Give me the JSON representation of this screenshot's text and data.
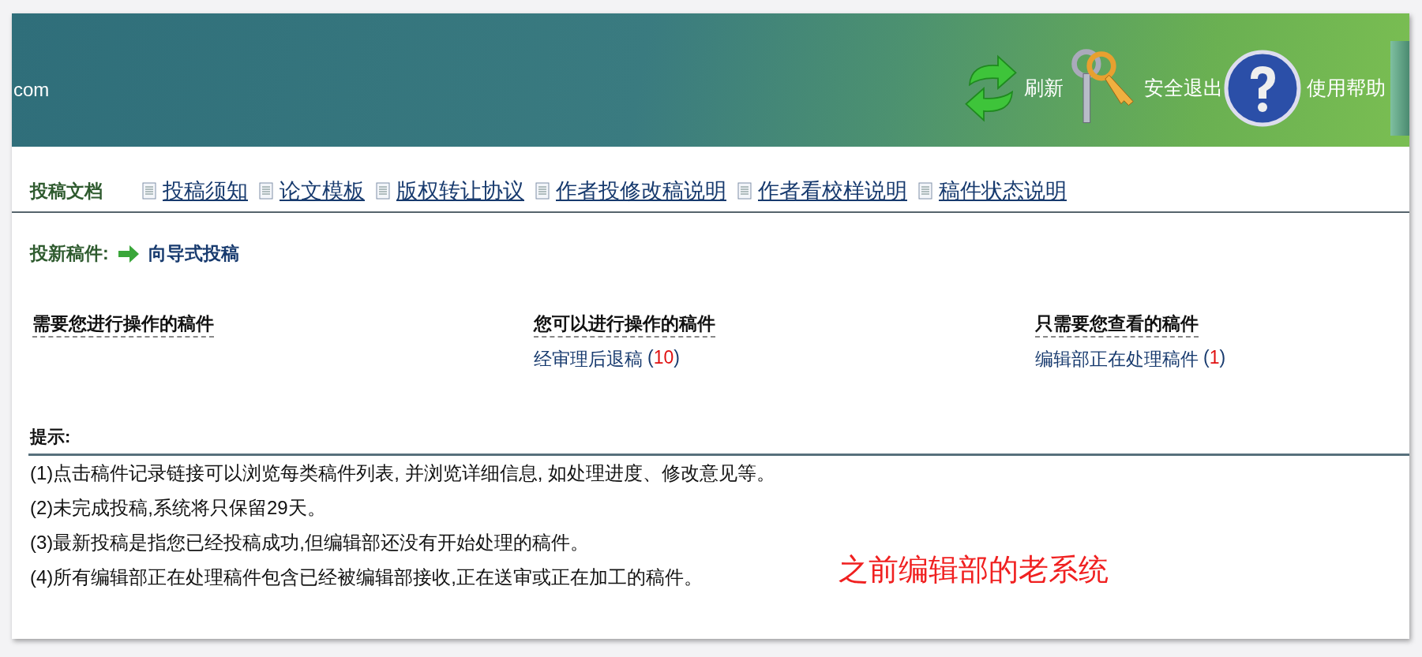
{
  "header": {
    "site_text": "com",
    "actions": [
      {
        "kind": "refresh",
        "label": "刷新"
      },
      {
        "kind": "logout",
        "label": "安全退出"
      },
      {
        "kind": "help",
        "label": "使用帮助"
      }
    ]
  },
  "docs": {
    "title": "投稿文档",
    "links": [
      "投稿须知",
      "论文模板",
      "版权转让协议",
      "作者投修改稿说明",
      "作者看校样说明",
      "稿件状态说明"
    ]
  },
  "new_submission": {
    "label": "投新稿件:",
    "link": "向导式投稿"
  },
  "columns": [
    {
      "heading": "需要您进行操作的稿件"
    },
    {
      "heading": "您可以进行操作的稿件",
      "items": [
        {
          "label": "经审理后退稿",
          "open": "(",
          "count": "10",
          "close": ")"
        }
      ]
    },
    {
      "heading": "只需要您查看的稿件",
      "items": [
        {
          "label": "编辑部正在处理稿件",
          "open": "(",
          "count": "1",
          "close": ")"
        }
      ]
    }
  ],
  "tips": {
    "title": "提示:",
    "lines": [
      "(1)点击稿件记录链接可以浏览每类稿件列表, 并浏览详细信息, 如处理进度、修改意见等。",
      "(2)未完成投稿,系统将只保留29天。",
      "(3)最新投稿是指您已经投稿成功,但编辑部还没有开始处理的稿件。",
      "(4)所有编辑部正在处理稿件包含已经被编辑部接收,正在送审或正在加工的稿件。"
    ]
  },
  "annotation": "之前编辑部的老系统"
}
